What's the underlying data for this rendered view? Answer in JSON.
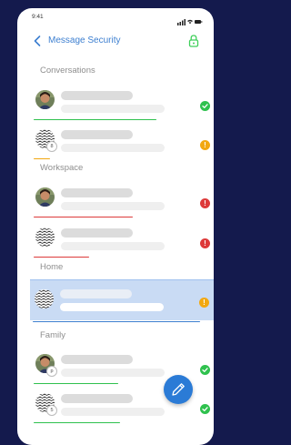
{
  "status_bar": {
    "time": "9:41"
  },
  "nav": {
    "back_icon": "chevron-left-icon",
    "title": "Message Security",
    "lock_icon": "lock-icon",
    "accent": "#3d7fd0",
    "lock_color": "#3fcf5a"
  },
  "sections": [
    {
      "title": "Conversations",
      "rows": [
        {
          "avatar": "photo",
          "status": "ok",
          "progress": 0.68
        },
        {
          "avatar": "pattern",
          "badge": "8",
          "status": "warning",
          "progress": 0.09
        }
      ]
    },
    {
      "title": "Workspace",
      "rows": [
        {
          "avatar": "photo",
          "status": "error",
          "progress": 0.55
        },
        {
          "avatar": "pattern",
          "status": "error",
          "progress": 0.31
        }
      ]
    },
    {
      "title": "Home",
      "rows": [
        {
          "avatar": "pattern",
          "status": "warning",
          "selected": true,
          "progress": 0.93
        }
      ]
    },
    {
      "title": "Family",
      "rows": [
        {
          "avatar": "photo",
          "badge": "p",
          "status": "ok",
          "progress": 0.47
        },
        {
          "avatar": "pattern",
          "badge": "5",
          "status": "ok",
          "progress": 0.48
        }
      ]
    }
  ],
  "status_colors": {
    "ok": "#2fc14e",
    "warning": "#f2a811",
    "error": "#dd3a3a"
  },
  "fab": {
    "icon": "pen-icon",
    "color": "#2b7bd6"
  }
}
